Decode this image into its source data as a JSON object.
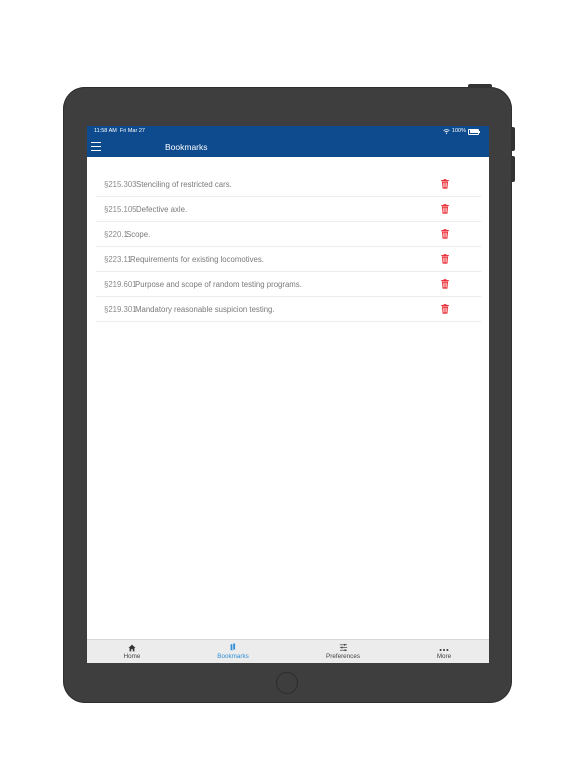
{
  "status_bar": {
    "time": "11:58 AM",
    "date": "Fri Mar 27",
    "battery": "100%"
  },
  "nav": {
    "title": "Bookmarks",
    "menu_icon": "hamburger-menu-icon"
  },
  "bookmarks": [
    {
      "code": "§215.303",
      "title": "Stenciling of restricted cars."
    },
    {
      "code": "§215.105",
      "title": "Defective axle."
    },
    {
      "code": "§220.1",
      "title": "Scope."
    },
    {
      "code": "§223.11",
      "title": "Requirements for existing locomotives."
    },
    {
      "code": "§219.601",
      "title": "Purpose and scope of random testing programs."
    },
    {
      "code": "§219.301",
      "title": "Mandatory reasonable suspicion testing."
    }
  ],
  "tabs": [
    {
      "label": "Home",
      "icon": "home-icon"
    },
    {
      "label": "Bookmarks",
      "icon": "bookmarks-icon",
      "active": true
    },
    {
      "label": "Preferences",
      "icon": "sliders-icon"
    },
    {
      "label": "More",
      "icon": "more-icon"
    }
  ],
  "colors": {
    "header": "#0e4a8e",
    "delete": "#e8242b",
    "active_tab": "#2f8fd8"
  }
}
